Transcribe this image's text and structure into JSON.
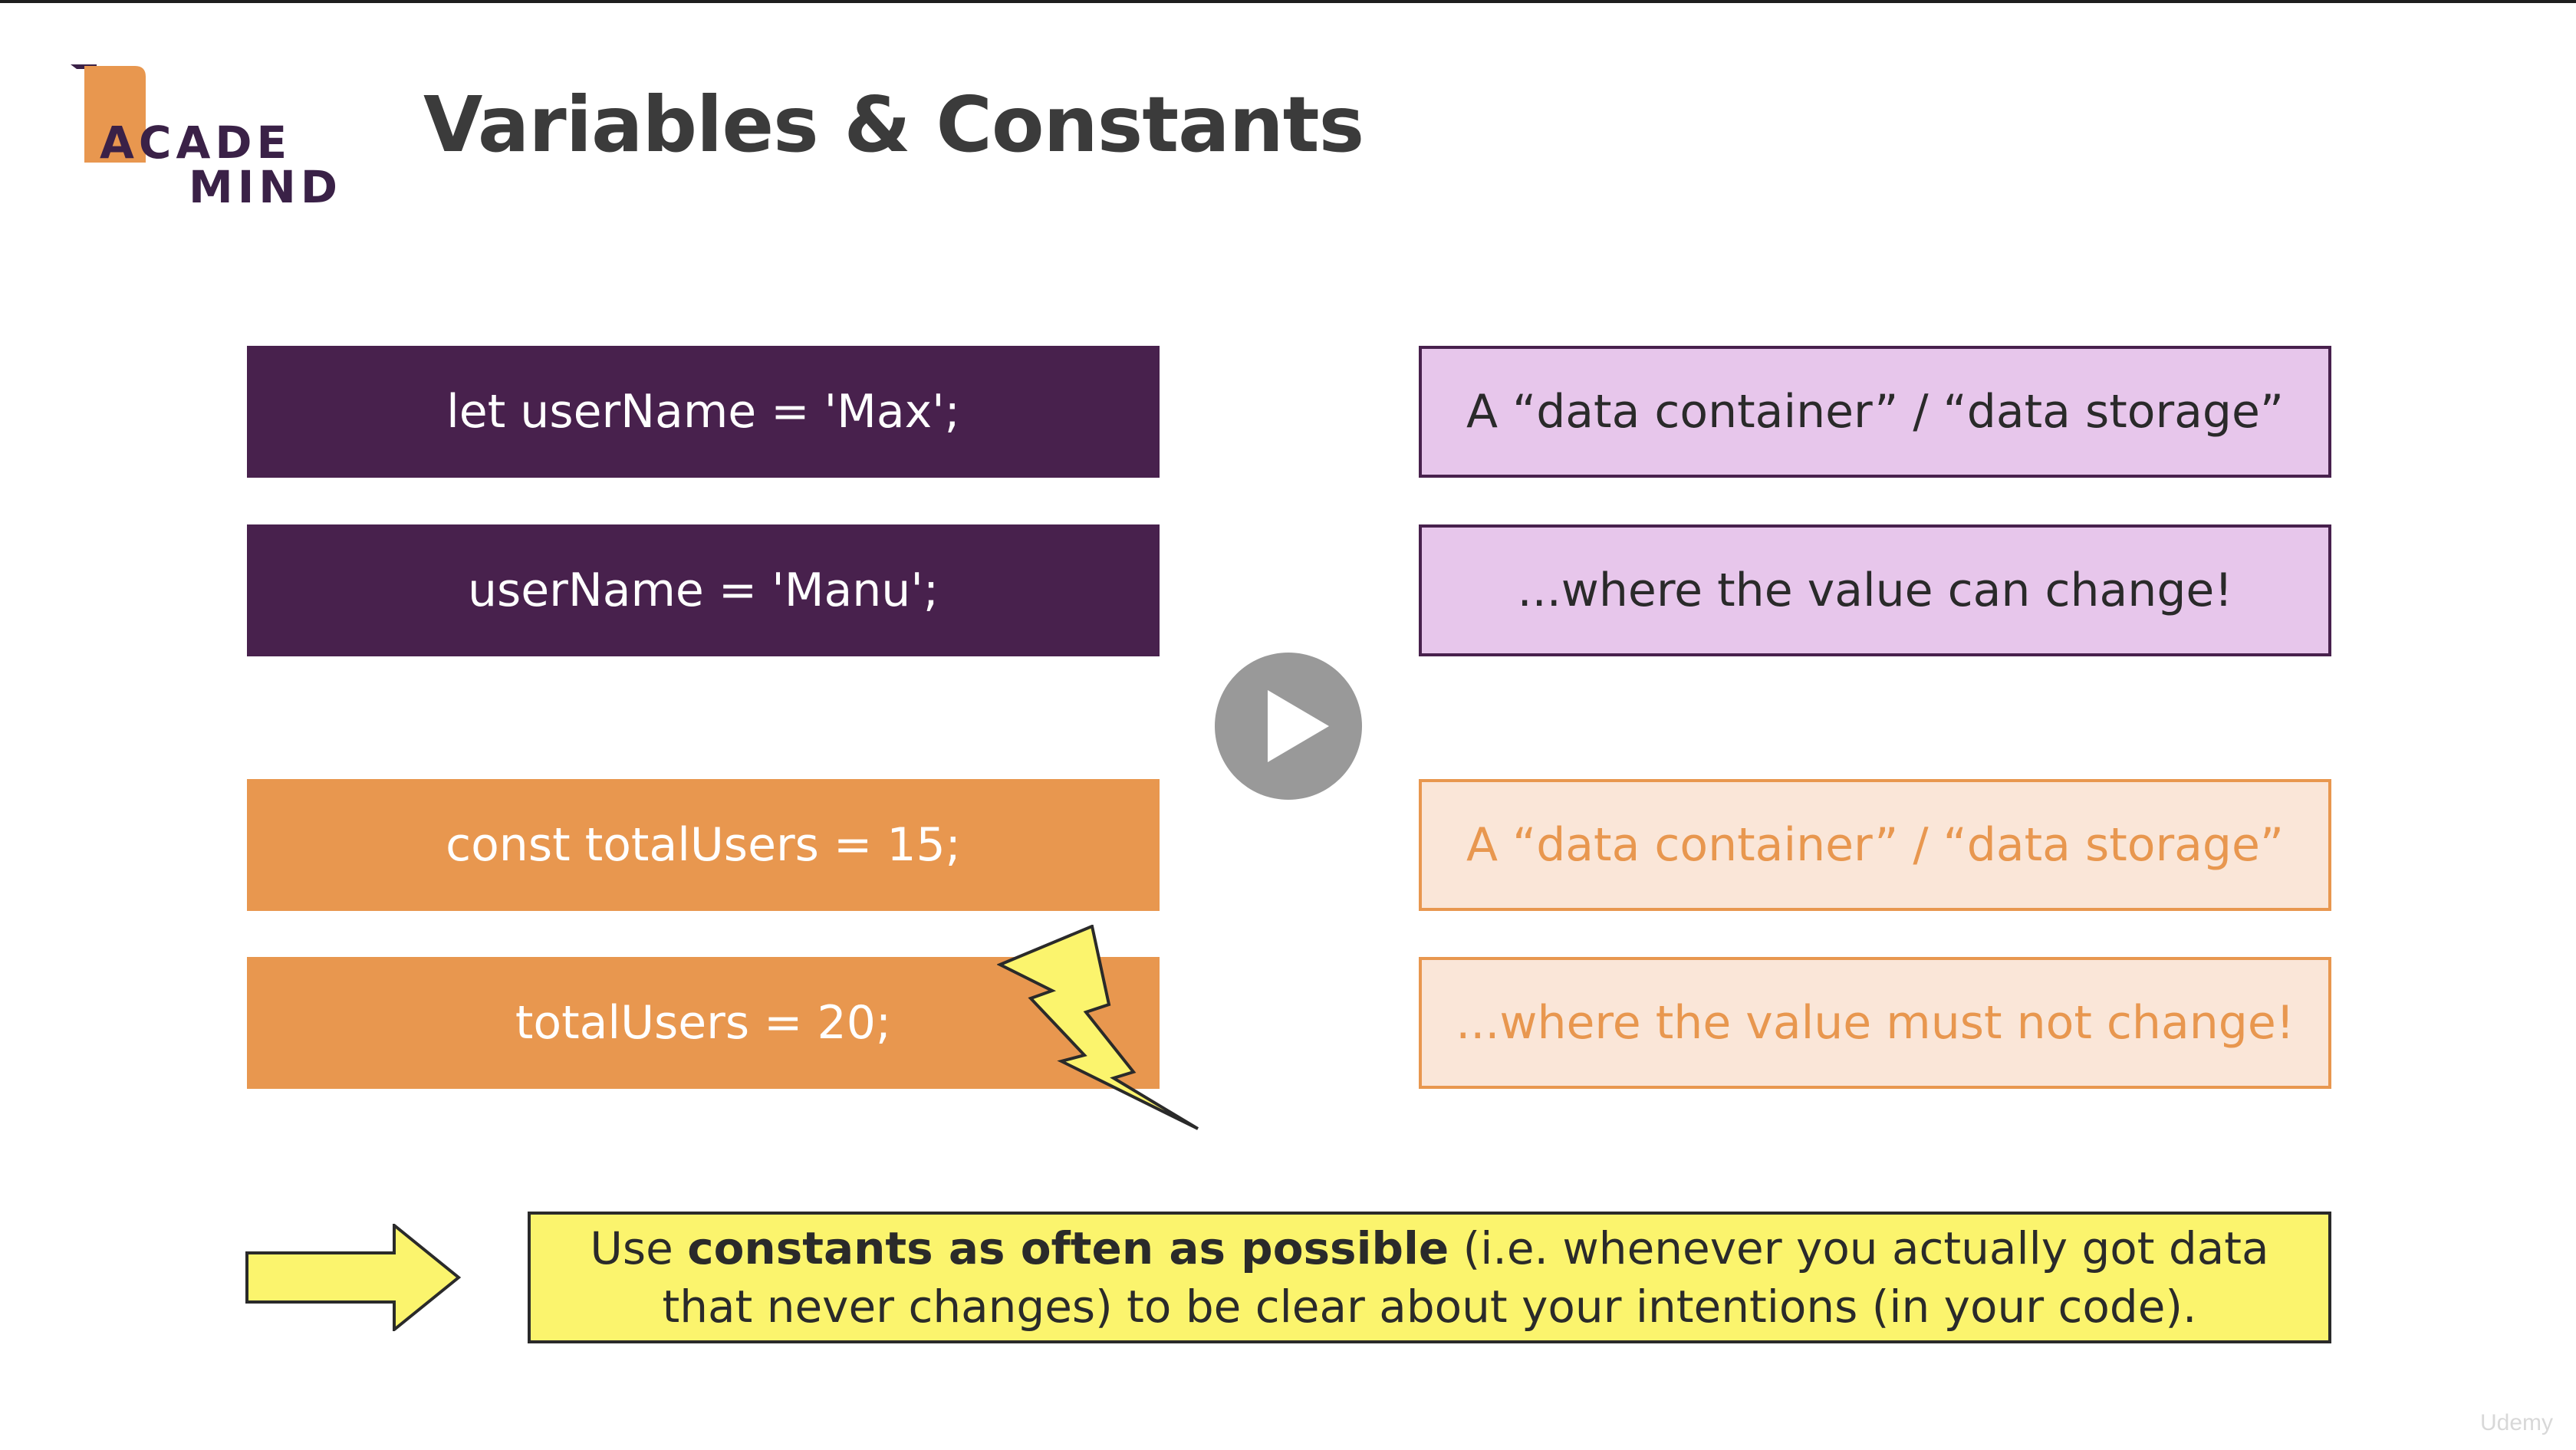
{
  "slide": {
    "title": "Variables & Constants",
    "logo": {
      "line1": "ACADE",
      "line2": "MIND",
      "brand_color": "#e8974f",
      "text_color": "#3a2147"
    },
    "rows": [
      {
        "code": "let userName = 'Max';",
        "desc": "A “data container” / “data storage”"
      },
      {
        "code": "userName = 'Manu';",
        "desc": "...where the value can change!"
      },
      {
        "code": "const totalUsers = 15;",
        "desc": "A “data container” / “data storage”"
      },
      {
        "code": "totalUsers = 20;",
        "desc": "...where the value must not change!"
      }
    ],
    "note": {
      "prefix": "Use ",
      "bold": "constants as often as possible",
      "suffix": " (i.e. whenever you actually got data that never changes) to be clear about your intentions (in your code)."
    },
    "icons": {
      "play": "play-button-icon",
      "bolt": "lightning-bolt-icon",
      "arrow": "right-arrow-icon"
    },
    "colors": {
      "variable_dark": "#48214d",
      "variable_light": "#e7c6eb",
      "constant_dark": "#e8974f",
      "constant_light": "#fae6d8",
      "note_yellow": "#fbf46d"
    }
  },
  "watermark": "Udemy"
}
